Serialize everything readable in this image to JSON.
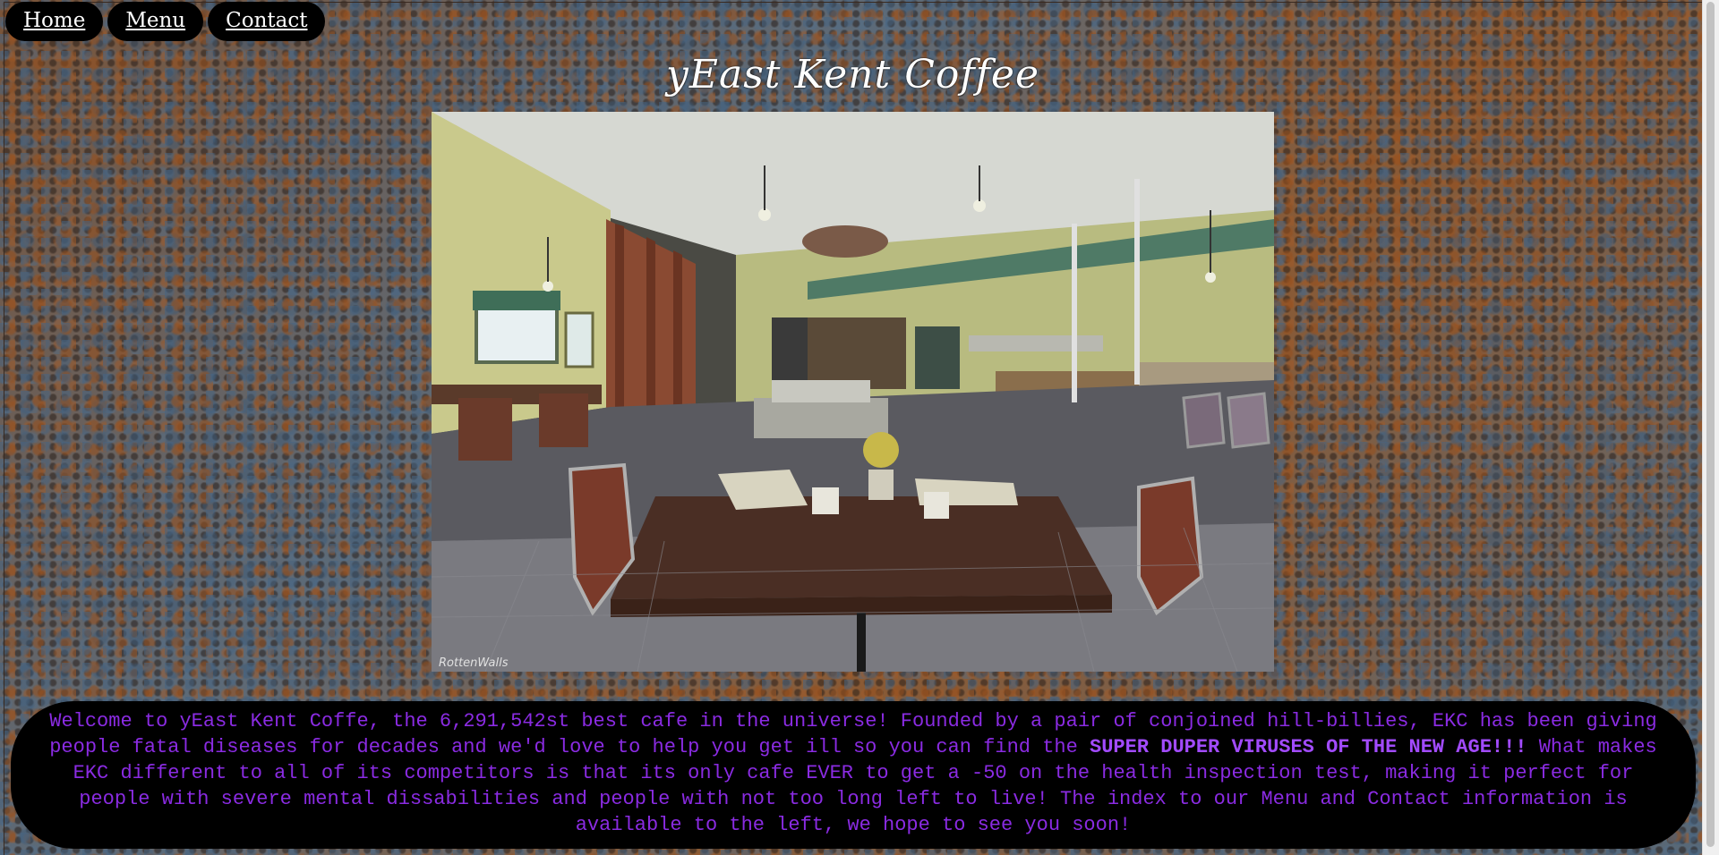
{
  "nav": {
    "items": [
      {
        "label": "Home"
      },
      {
        "label": "Menu"
      },
      {
        "label": "Contact"
      }
    ]
  },
  "header": {
    "title": "yEast Kent Coffee"
  },
  "main": {
    "photo_watermark": "RottenWalls",
    "welcome": {
      "part1": "Welcome to yEast Kent Coffe, the 6,291,542st best cafe in the universe! Founded by a pair of conjoined hill-billies, EKC has been giving people fatal diseases for decades and we'd love to help you get ill so you can find the ",
      "highlight": "SUPER DUPER VIRUSES OF THE NEW AGE!!!",
      "part2": " What makes EKC different to all of its competitors is that its only cafe EVER to get a -50 on the health inspection test, making it perfect for people with severe mental dissabilities and people with not too long left to live! The index to our Menu and Contact information is available to the left, we hope to see you soon!"
    }
  },
  "colors": {
    "nav_background": "#000000",
    "welcome_text": "#8a2be2",
    "title_text": "#ffffff"
  }
}
